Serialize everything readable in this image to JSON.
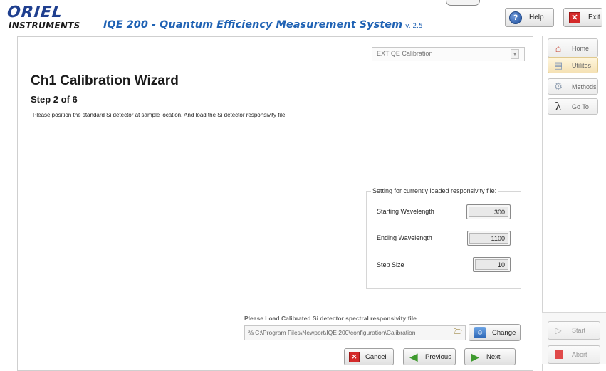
{
  "logo": {
    "top": "ORIEL",
    "bottom": "INSTRUMENTS"
  },
  "app": {
    "title": "IQE 200 - Quantum Efficiency Measurement System",
    "version": "v. 2.5"
  },
  "header": {
    "help_label": "Help",
    "exit_label": "Exit"
  },
  "mode_select": {
    "value": "EXT QE Calibration"
  },
  "wizard": {
    "title": "Ch1 Calibration Wizard",
    "step": "Step 2 of  6",
    "instructions": "Please position the standard Si detector at sample location. And load the Si detector responsivity file"
  },
  "settings": {
    "legend": "Setting for currently loaded responsivity file:",
    "starting_wavelength_label": "Starting Wavelength",
    "starting_wavelength": "300",
    "ending_wavelength_label": "Ending Wavelength",
    "ending_wavelength": "1100",
    "step_size_label": "Step Size",
    "step_size": "10"
  },
  "file": {
    "prompt": "Please Load Calibrated Si detector spectral responsivity file",
    "path": "C:\\Program Files\\Newport\\IQE 200\\configuration\\Calibration"
  },
  "buttons": {
    "change": "Change",
    "cancel": "Cancel",
    "previous": "Previous",
    "next": "Next"
  },
  "sidebar": {
    "home": "Home",
    "utilities": "Utilites",
    "methods": "Methods",
    "goto": "Go To",
    "start": "Start",
    "abort": "Abort"
  },
  "icons": {
    "help": "help-icon",
    "exit": "close-icon",
    "home": "home-icon",
    "utilities": "clipboard-icon",
    "methods": "gear-icon",
    "goto": "lambda-icon",
    "start": "play-icon",
    "abort": "stop-icon",
    "change": "person-icon",
    "cancel": "close-icon",
    "previous": "arrow-left-icon",
    "next": "arrow-right-icon",
    "browse": "folder-icon"
  },
  "colors": {
    "brand_blue": "#1f62b4",
    "accent_red": "#d42a2a",
    "accent_green": "#3e9a2e"
  }
}
